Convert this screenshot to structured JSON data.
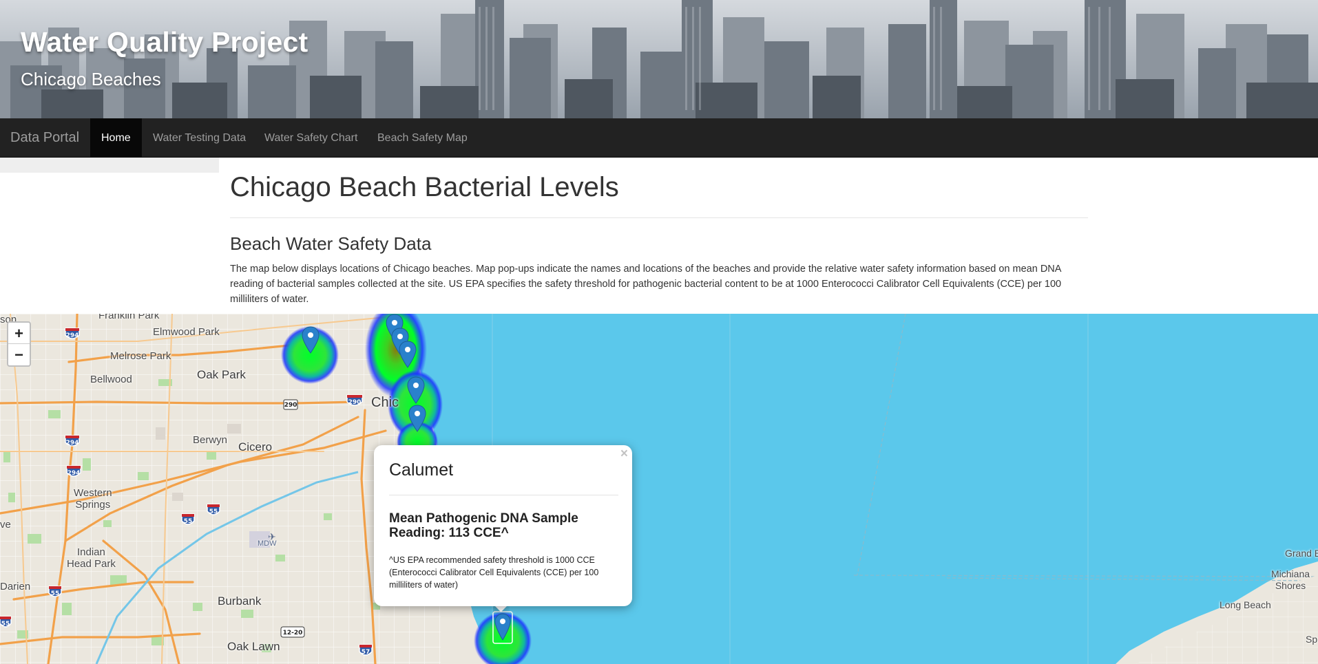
{
  "header": {
    "title": "Water Quality Project",
    "subtitle": "Chicago Beaches"
  },
  "navbar": {
    "brand": "Data Portal",
    "items": [
      {
        "label": "Home",
        "active": true
      },
      {
        "label": "Water Testing Data",
        "active": false
      },
      {
        "label": "Water Safety Chart",
        "active": false
      },
      {
        "label": "Beach Safety Map",
        "active": false
      }
    ]
  },
  "main": {
    "title": "Chicago Beach Bacterial Levels",
    "section_title": "Beach Water Safety Data",
    "section_text": "The map below displays locations of Chicago beaches. Map pop-ups indicate the names and locations of the beaches and provide the relative water safety information based on mean DNA reading of bacterial samples collected at the site. US EPA specifies the safety threshold for pathogenic bacterial content to be at 1000 Enterococci Calibrator Cell Equivalents (CCE) per 100 milliliters of water."
  },
  "map": {
    "zoom_in": "+",
    "zoom_out": "−",
    "labels": {
      "franklin_park": "Franklin Park",
      "son": "son",
      "elmwood_park": "Elmwood Park",
      "melrose_park": "Melrose Park",
      "oak_park": "Oak Park",
      "bellwood": "Bellwood",
      "chicago": "Chic",
      "berwyn": "Berwyn",
      "cicero": "Cicero",
      "western_springs": "Western\nSprings",
      "ve": "ve",
      "indian_head_park": "Indian\nHead Park",
      "mdw": "MDW",
      "darien": "Darien",
      "burbank": "Burbank",
      "oak_lawn": "Oak Lawn",
      "grand_b": "Grand B",
      "michiana_shores": "Michiana\nShores",
      "long_beach": "Long Beach",
      "sp": "Sp"
    },
    "shields": {
      "i294_a": "294",
      "i294_b": "294",
      "i294_c": "294",
      "us290": "290",
      "i290": "290",
      "i55_a": "55",
      "i55_b": "55",
      "i55_c": "55",
      "i55_d": "55",
      "rt1220": "12-20",
      "i57": "57"
    },
    "heat_colors": {
      "low": "#00ff2a",
      "edge": "#1a33ff"
    },
    "water_color": "#5bc8eb",
    "marker_color": "#2a81cb"
  },
  "popup": {
    "close": "×",
    "title": "Calumet",
    "reading": "Mean Pathogenic DNA Sample Reading: 113 CCE^",
    "note": "^US EPA recommended safety threshold is 1000 CCE (Enterococci Calibrator Cell Equivalents (CCE) per 100 milliliters of water)"
  }
}
